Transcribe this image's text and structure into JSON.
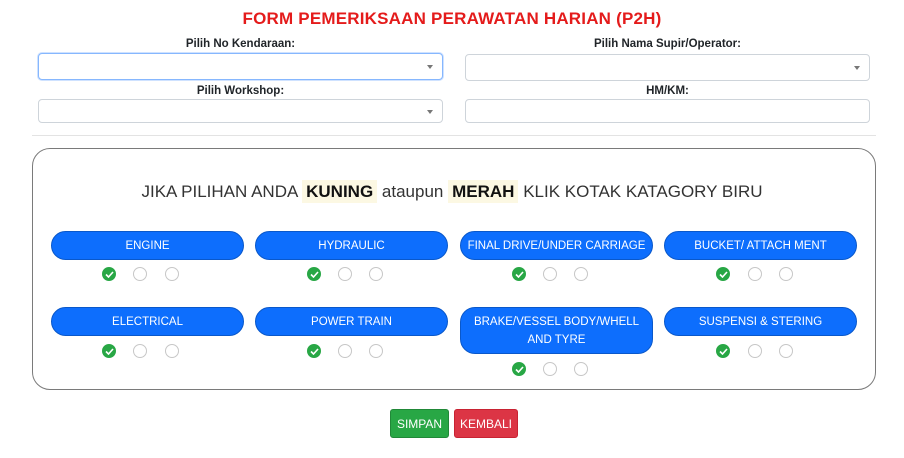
{
  "title": "FORM PEMERIKSAAN PERAWATAN HARIAN (P2H)",
  "fields": {
    "vehicle_label": "Pilih No Kendaraan:",
    "driver_label": "Pilih Nama Supir/Operator:",
    "workshop_label": "Pilih Workshop:",
    "hmkm_label": "HM/KM:",
    "vehicle_value": "",
    "driver_value": "",
    "workshop_value": "",
    "hmkm_value": ""
  },
  "notice": {
    "prefix": "JIKA PILIHAN ANDA",
    "yellow": "KUNING",
    "middle": "ataupun",
    "red": "MERAH",
    "suffix": "KLIK KOTAK KATAGORY BIRU"
  },
  "categories": [
    {
      "label": "ENGINE",
      "selected": "green"
    },
    {
      "label": "HYDRAULIC",
      "selected": "green"
    },
    {
      "label": "FINAL DRIVE/UNDER CARRIAGE",
      "selected": "green"
    },
    {
      "label": "BUCKET/ ATTACH MENT",
      "selected": "green"
    },
    {
      "label": "ELECTRICAL",
      "selected": "green"
    },
    {
      "label": "POWER TRAIN",
      "selected": "green"
    },
    {
      "label": "BRAKE/VESSEL BODY/WHELL AND TYRE",
      "selected": "green"
    },
    {
      "label": "SUSPENSI & STERING",
      "selected": "green"
    }
  ],
  "colors": {
    "primary": "#0d6efd",
    "success": "#28a745",
    "danger": "#dc3545",
    "title": "#e41b1b"
  },
  "buttons": {
    "save": "SIMPAN",
    "back": "KEMBALI"
  }
}
